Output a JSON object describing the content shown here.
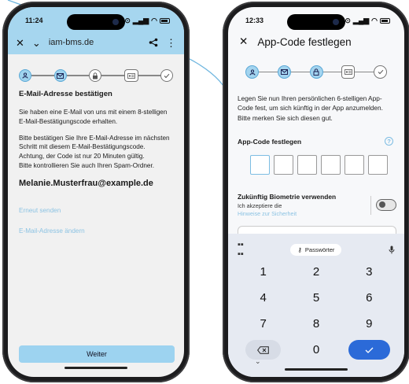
{
  "left": {
    "status": {
      "time": "11:24"
    },
    "browser": {
      "close_label": "✕",
      "down_label": "⌄",
      "url": "iam-bms.de",
      "share_label": "⇪",
      "menu_label": "⋮"
    },
    "title": "E-Mail-Adresse bestätigen",
    "para1": "Sie haben eine E-Mail von uns mit einem 8-stelligen E-Mail-Bestätigungscode erhalten.",
    "para2_line1": "Bitte bestätigen Sie Ihre E-Mail-Adresse im nächsten Schritt mit diesem E-Mail-Bestätigungscode.",
    "para2_line2": "Achtung, der Code ist nur 20 Minuten gültig.",
    "para2_line3": "Bitte kontrollieren Sie auch Ihren Spam-Ordner.",
    "email": "Melanie.Musterfrau@example.de",
    "link_resend": "Erneut senden",
    "link_change": "E-Mail-Adresse ändern",
    "button_next": "Weiter"
  },
  "right": {
    "status": {
      "time": "12:33"
    },
    "close_label": "✕",
    "title": "App-Code festlegen",
    "description": "Legen Sie nun Ihren persönlichen 6-stelligen App-Code fest, um sich künftig in der App anzumelden. Bitte merken Sie sich diesen gut.",
    "code_label": "App-Code festlegen",
    "help_label": "?",
    "biometrics": {
      "title": "Zukünftig Biometrie verwenden",
      "accept": "Ich akzeptiere die",
      "link": "Hinweise zur Sicherheit"
    },
    "keyboard": {
      "passwords_chip": "Passwörter",
      "keys": [
        "1",
        "2",
        "3",
        "4",
        "5",
        "6",
        "7",
        "8",
        "9"
      ],
      "zero": "0",
      "chevron": "⌄"
    }
  },
  "colors": {
    "accent": "#9dd3f0",
    "link": "#8cc3e3",
    "keyboard_ok": "#2b6ad8"
  }
}
